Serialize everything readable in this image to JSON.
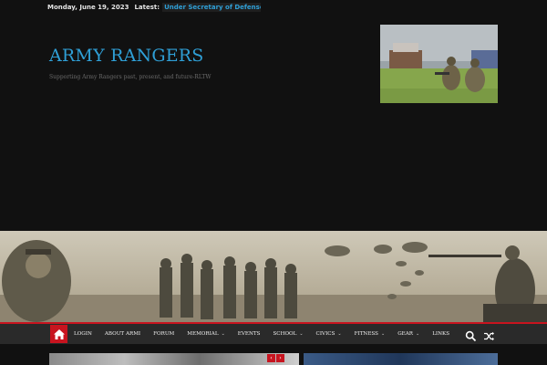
{
  "topbar": {
    "date": "Monday, June 19, 2023",
    "latest_label": "Latest:",
    "ticker_text": "Under Secretary of Defense for"
  },
  "header": {
    "site_title": "ARMY RANGERS",
    "tagline": "Supporting Army Rangers past, present, and future-RLTW"
  },
  "nav": {
    "items": [
      {
        "label": "LOGIN",
        "has_dropdown": false
      },
      {
        "label": "ABOUT ARMI",
        "has_dropdown": false
      },
      {
        "label": "FORUM",
        "has_dropdown": false
      },
      {
        "label": "MEMORIAL",
        "has_dropdown": true
      },
      {
        "label": "EVENTS",
        "has_dropdown": false
      },
      {
        "label": "SCHOOL",
        "has_dropdown": true
      },
      {
        "label": "CIVICS",
        "has_dropdown": true
      },
      {
        "label": "FITNESS",
        "has_dropdown": true
      },
      {
        "label": "GEAR",
        "has_dropdown": true
      },
      {
        "label": "LINKS",
        "has_dropdown": false
      }
    ],
    "caret": "⌄",
    "home_icon": "home-icon",
    "search_icon": "search-icon",
    "random_icon": "shuffle-icon"
  },
  "slider": {
    "prev": "‹",
    "next": "›"
  },
  "colors": {
    "accent": "#2f9fd6",
    "nav_red": "#c8141f",
    "background": "#111111",
    "nav_bg": "#2a2a2a"
  }
}
